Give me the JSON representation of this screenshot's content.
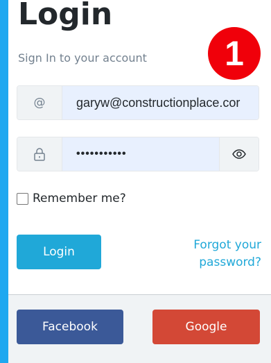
{
  "login": {
    "title": "Login",
    "subtitle": "Sign In to your account",
    "badge": "1",
    "email": {
      "icon_glyph": "@",
      "value": "garyw@constructionplace.cor"
    },
    "password": {
      "masked_value": "•••••••••••"
    },
    "remember_label": "Remember me?",
    "login_button": "Login",
    "forgot_line1": "Forgot your",
    "forgot_line2": "password?",
    "facebook_button": "Facebook",
    "google_button": "Google"
  },
  "colors": {
    "accent": "#20a8d8",
    "facebook": "#3b5998",
    "google": "#d34836",
    "badge": "#f0000a",
    "page_background": "#1fa8f0"
  },
  "icons": {
    "email": "at-sign-icon",
    "password": "lock-icon",
    "toggle": "eye-icon"
  }
}
